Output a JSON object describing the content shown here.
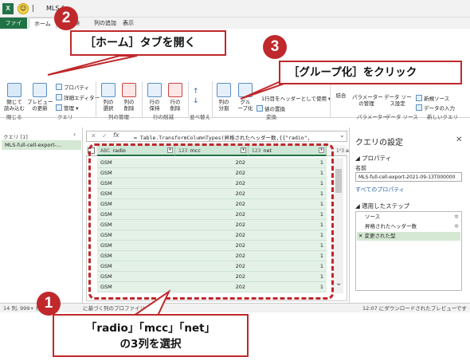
{
  "window": {
    "title": "MLS-f"
  },
  "ribbon_tabs": [
    "ファイル",
    "ホーム",
    "変換",
    "列の追加",
    "表示"
  ],
  "ribbon": {
    "close_apply": "閉じて\n読み込む",
    "preview_refresh": "プレビュー\nの更新",
    "properties": "プロパティ",
    "advanced_editor": "詳細エディター",
    "manage": "管理",
    "choose_cols": "列の\n選択",
    "remove_cols": "列の\n削除",
    "keep_rows": "行の\n保持",
    "remove_rows": "行の\n削除",
    "split_col": "列の\n分割",
    "group_by": "グル\nープ化",
    "use_first_row": "1行目をヘッダーとして使用",
    "replace_values": "値の置換",
    "merge": "結合",
    "params": "パラメーター\nの管理",
    "datasource": "データ ソー\nス設定",
    "new_source": "新規ソース",
    "enter_data": "データの入力",
    "groups": [
      "閉じる",
      "クエリ",
      "列の管理",
      "行の削減",
      "並べ替え",
      "変換",
      "パラメーター",
      "データ ソース",
      "新しいクエリ"
    ]
  },
  "queries": {
    "header": "クエリ [1]",
    "item": "MLS-full-cell-export-..."
  },
  "formula": {
    "text": "= Table.TransformColumnTypes(昇格されたヘッダー数,{{\"radio\","
  },
  "columns": [
    {
      "type": "ABC",
      "name": "radio"
    },
    {
      "type": "123",
      "name": "mcc"
    },
    {
      "type": "123",
      "name": "net"
    }
  ],
  "extra_column": "are",
  "rows": [
    [
      "GSM",
      "202",
      "1"
    ],
    [
      "GSM",
      "202",
      "1"
    ],
    [
      "GSM",
      "202",
      "1"
    ],
    [
      "GSM",
      "202",
      "1"
    ],
    [
      "GSM",
      "202",
      "1"
    ],
    [
      "GSM",
      "202",
      "1"
    ],
    [
      "GSM",
      "202",
      "1"
    ],
    [
      "GSM",
      "202",
      "1"
    ],
    [
      "GSM",
      "202",
      "1"
    ],
    [
      "GSM",
      "202",
      "1"
    ],
    [
      "GSM",
      "202",
      "1"
    ],
    [
      "GSM",
      "202",
      "1"
    ],
    [
      "GSM",
      "202",
      "1"
    ]
  ],
  "settings": {
    "title": "クエリの設定",
    "properties_header": "プロパティ",
    "name_label": "名前",
    "name_value": "MLS-full-cell-export-2021-09-13T000000",
    "all_properties": "すべてのプロパティ",
    "steps_header": "適用したステップ",
    "steps": [
      "ソース",
      "昇格されたヘッダー数",
      "変更された型"
    ]
  },
  "status": {
    "left": "14 列, 999+ 行",
    "mid": "に基づく列のプロファイリング",
    "right": "12:07 にダウンロードされたプレビューです"
  },
  "callouts": {
    "c1": {
      "num": "1",
      "line1": "「radio」「mcc」「net」",
      "line2": "の3列を選択"
    },
    "c2": {
      "num": "2",
      "text": "［ホーム］タブを開く"
    },
    "c3": {
      "num": "3",
      "text": "［グループ化］をクリック"
    }
  },
  "colors": {
    "accent": "#217346",
    "callout": "#c0282b",
    "selection": "#e3f1e7"
  }
}
